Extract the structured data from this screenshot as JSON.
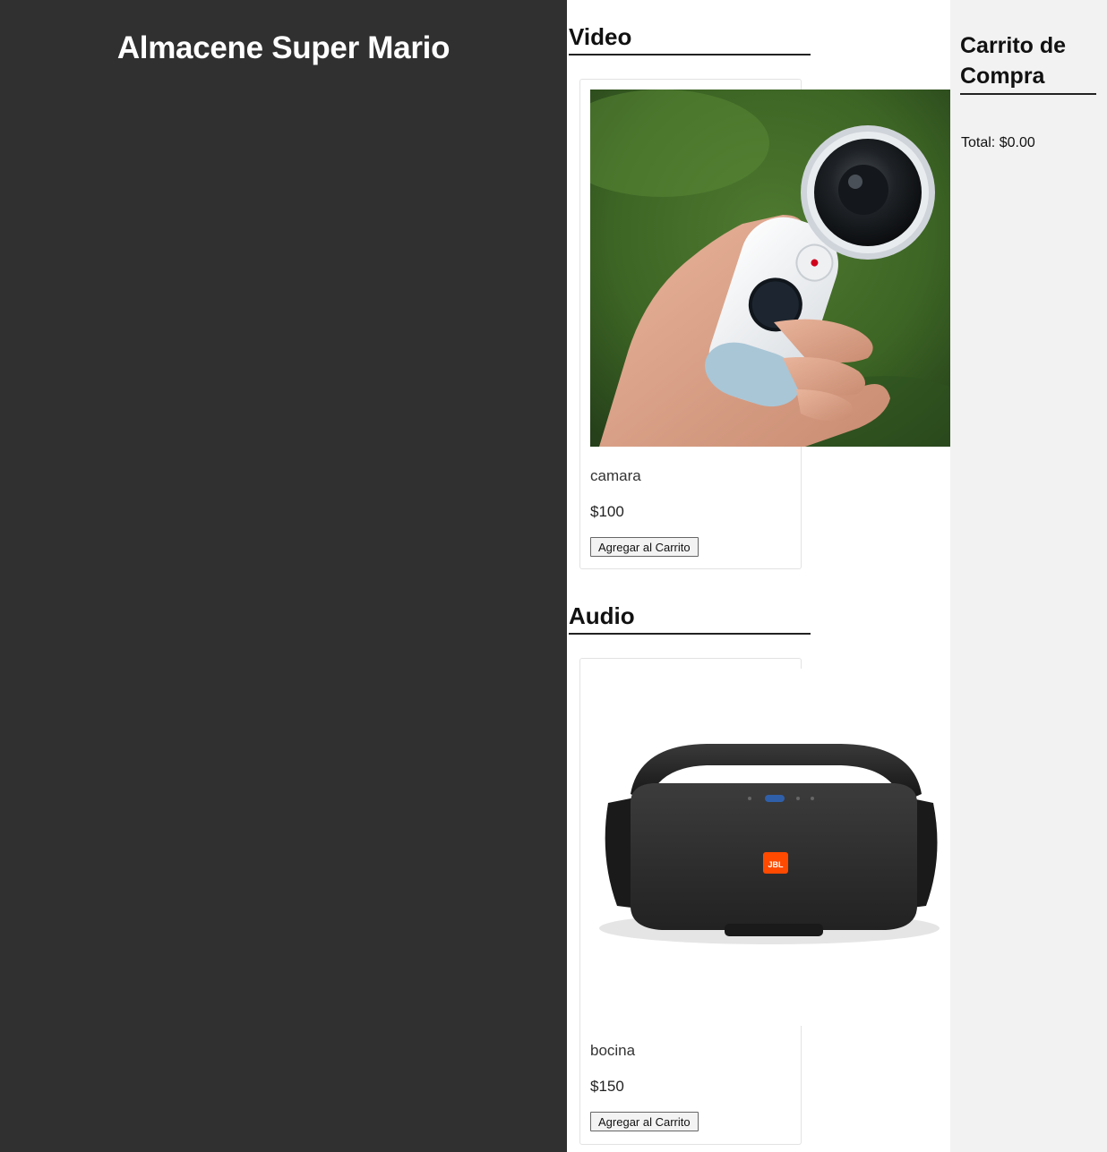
{
  "store": {
    "title": "Almacene Super Mario"
  },
  "sections": [
    {
      "title": "Video",
      "product": {
        "name": "camara",
        "price": "$100",
        "button_label": "Agregar al Carrito",
        "image": "360-camera-in-hand"
      }
    },
    {
      "title": "Audio",
      "product": {
        "name": "bocina",
        "price": "$150",
        "button_label": "Agregar al Carrito",
        "image": "portable-bluetooth-speaker"
      }
    }
  ],
  "cart": {
    "title": "Carrito de Compra",
    "total_label": "Total:",
    "total_value": "$0.00",
    "logo_text": "JBL"
  },
  "colors": {
    "sidebar": "#303030",
    "cart_panel": "#f2f2f2",
    "speaker_logo": "#ff4a00"
  }
}
